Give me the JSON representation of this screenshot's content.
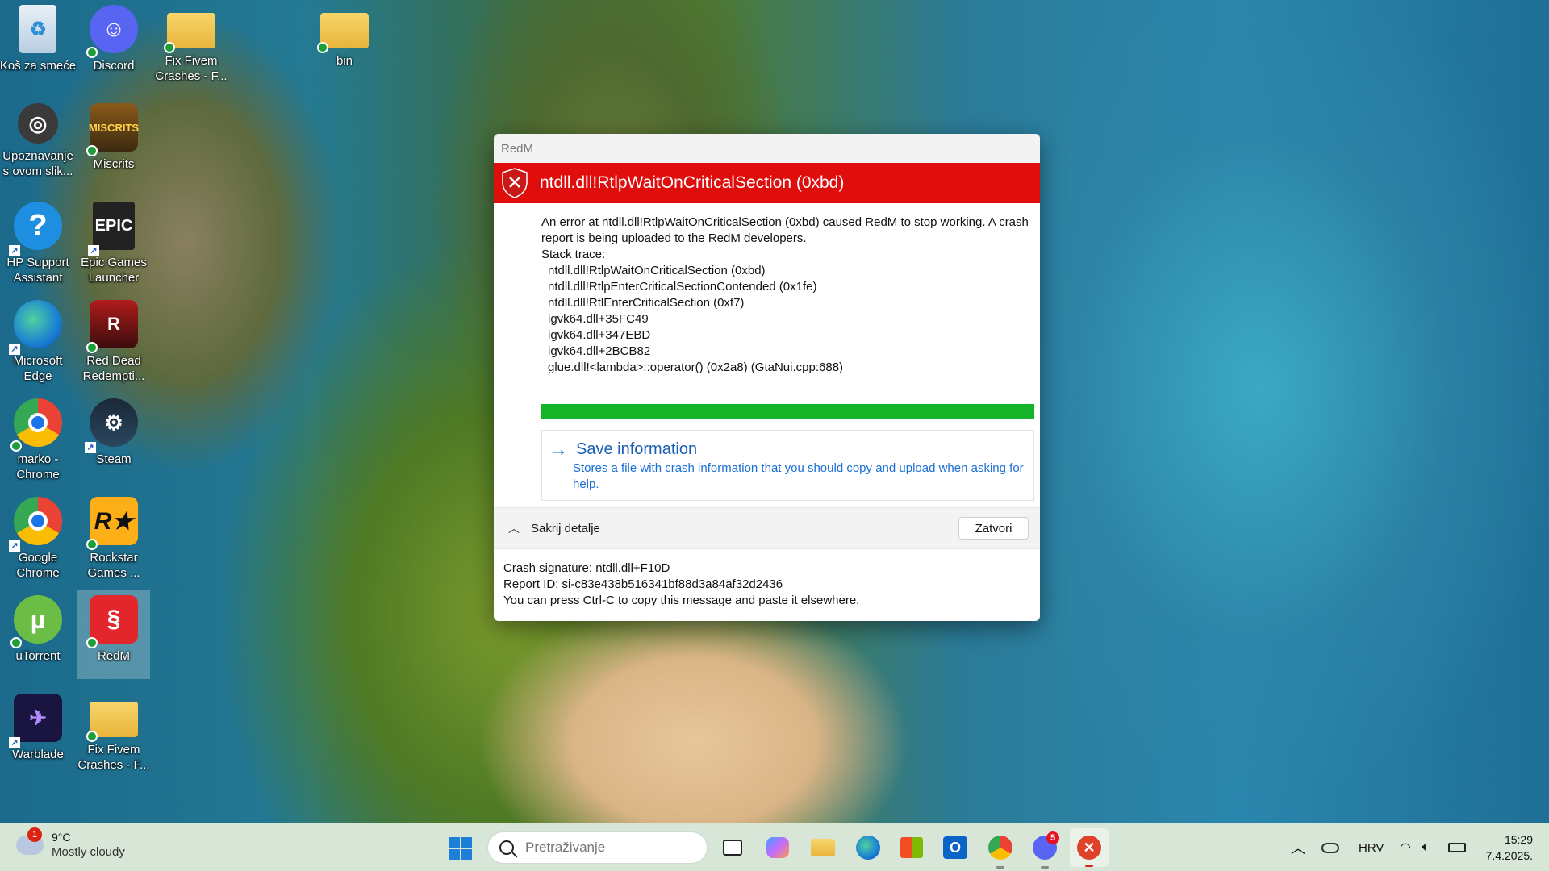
{
  "desktop": {
    "icons": [
      {
        "label": "Koš za smeće",
        "icon": "recycle-bin-icon"
      },
      {
        "label": "Discord",
        "icon": "discord-icon"
      },
      {
        "label": "Fix Fivem Crashes - F...",
        "icon": "folder-icon"
      },
      {
        "label": "bin",
        "icon": "folder-icon"
      },
      {
        "label": "Upoznavanje s ovom slik...",
        "icon": "camera-icon"
      },
      {
        "label": "Miscrits",
        "icon": "miscrits-icon"
      },
      {
        "label": "HP Support Assistant",
        "icon": "help-icon"
      },
      {
        "label": "Epic Games Launcher",
        "icon": "epic-games-icon"
      },
      {
        "label": "Microsoft Edge",
        "icon": "edge-icon"
      },
      {
        "label": "Red Dead Redempti...",
        "icon": "red-dead-icon"
      },
      {
        "label": "marko - Chrome",
        "icon": "chrome-icon"
      },
      {
        "label": "Steam",
        "icon": "steam-icon"
      },
      {
        "label": "Google Chrome",
        "icon": "chrome-icon"
      },
      {
        "label": "Rockstar Games ...",
        "icon": "rockstar-icon"
      },
      {
        "label": "uTorrent",
        "icon": "utorrent-icon"
      },
      {
        "label": "RedM",
        "icon": "redm-icon"
      },
      {
        "label": "Warblade",
        "icon": "warblade-icon"
      },
      {
        "label": "Fix Fivem Crashes - F...",
        "icon": "folder-icon"
      }
    ]
  },
  "dialog": {
    "window_title": "RedM",
    "header_title": "ntdll.dll!RtlpWaitOnCriticalSection (0xbd)",
    "message_line1": "An error at ntdll.dll!RtlpWaitOnCriticalSection (0xbd) caused RedM to stop working. A crash",
    "message_line2": "report is being uploaded to the RedM developers.",
    "stack_label": "Stack trace:",
    "stack_trace": [
      "ntdll.dll!RtlpWaitOnCriticalSection (0xbd)",
      "ntdll.dll!RtlpEnterCriticalSectionContended (0x1fe)",
      "ntdll.dll!RtlEnterCriticalSection (0xf7)",
      "igvk64.dll+35FC49",
      "igvk64.dll+347EBD",
      "igvk64.dll+2BCB82",
      "glue.dll!<lambda>::operator() (0x2a8) (GtaNui.cpp:688)"
    ],
    "progress": 1.0,
    "save_title": "Save information",
    "save_desc_line1": "Stores a file with crash information that you should copy and upload when asking for",
    "save_desc_line2": "help.",
    "toggle_details": "Sakrij detalje",
    "close_button": "Zatvori",
    "crash_signature": "Crash signature: ntdll.dll+F10D",
    "report_id": "Report ID: si-c83e438b516341bf88d3a84af32d2436",
    "copy_hint": "You can press Ctrl-C to copy this message and paste it elsewhere.",
    "accent": "#e00d0d",
    "progress_color": "#15b327"
  },
  "taskbar": {
    "weather_badge": "1",
    "temperature": "9°C",
    "weather_desc": "Mostly cloudy",
    "search_placeholder": "Pretraživanje",
    "apps": [
      {
        "name": "task-view",
        "icon": "task-view-icon"
      },
      {
        "name": "copilot",
        "icon": "copilot-icon"
      },
      {
        "name": "file-explorer",
        "icon": "folder-icon"
      },
      {
        "name": "edge",
        "icon": "edge-icon"
      },
      {
        "name": "store",
        "icon": "store-icon"
      },
      {
        "name": "outlook",
        "icon": "outlook-icon",
        "label": "O"
      },
      {
        "name": "chrome",
        "icon": "chrome-icon"
      },
      {
        "name": "discord",
        "icon": "discord-icon",
        "badge": "5"
      },
      {
        "name": "redm",
        "icon": "redm-icon"
      }
    ],
    "language": "HRV",
    "time": "15:29",
    "date": "7.4.2025."
  }
}
